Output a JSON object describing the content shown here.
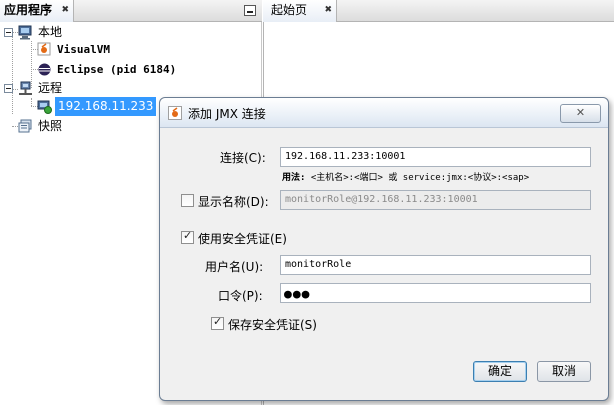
{
  "left_panel": {
    "tab_label": "应用程序",
    "tab_close": "✖",
    "tree": {
      "local": {
        "label": "本地",
        "children": [
          "VisualVM",
          "Eclipse (pid 6184)"
        ]
      },
      "remote": {
        "label": "远程",
        "children": [
          "192.168.11.233"
        ]
      },
      "snapshots": {
        "label": "快照"
      }
    }
  },
  "right_area": {
    "tab_label": "起始页",
    "tab_close": "✖"
  },
  "dialog": {
    "title": "添加 JMX 连接",
    "close_glyph": "✕",
    "connection_label": "连接(C):",
    "connection_value": "192.168.11.233:10001",
    "usage_label": "用法:",
    "usage_text": "<主机名>:<端口> 或 service:jmx:<协议>:<sap>",
    "display_name_label": "显示名称(D):",
    "display_name_checked": false,
    "display_name_value": "monitorRole@192.168.11.233:10001",
    "security_label": "使用安全凭证(E)",
    "security_checked": true,
    "username_label": "用户名(U):",
    "username_value": "monitorRole",
    "password_label": "口令(P):",
    "password_mask": "●●●",
    "save_security_label": "保存安全凭证(S)",
    "save_security_checked": true,
    "ok_label": "确定",
    "cancel_label": "取消"
  }
}
